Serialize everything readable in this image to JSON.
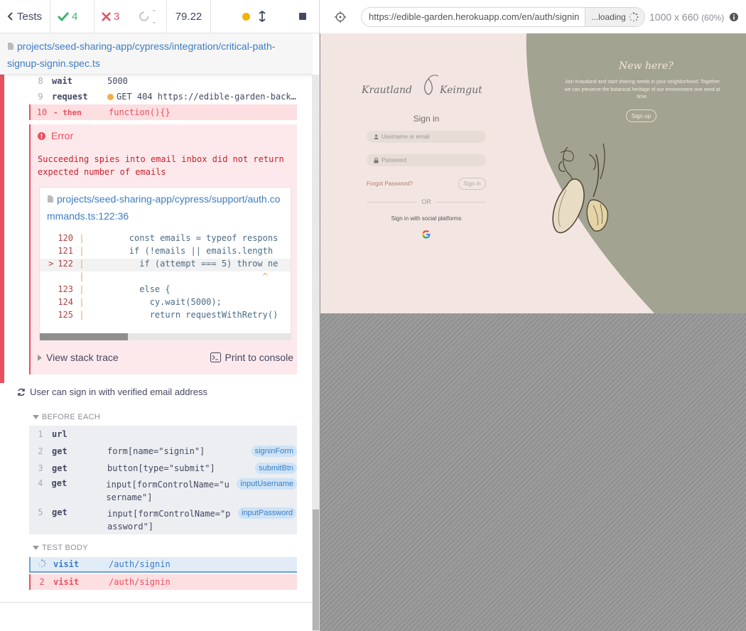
{
  "stats": {
    "tests_label": "Tests",
    "passed": "4",
    "failed": "3",
    "pending": "--",
    "duration": "79.22"
  },
  "spec": {
    "path": "projects/seed-sharing-app/cypress/integration/critical-path-signup-signin.spec.ts"
  },
  "prev_commands": [
    {
      "num": "8",
      "name": "wait",
      "message": "5000"
    },
    {
      "num": "9",
      "name": "request",
      "message": "GET 404 https://edible-garden-backend.h…"
    },
    {
      "num": "10",
      "name": "- then",
      "message": "function(){}"
    }
  ],
  "error": {
    "title": "Error",
    "message": "Succeeding spies into email inbox did not return expected number of emails",
    "file": "projects/seed-sharing-app/cypress/support/auth.commands.ts:122:36",
    "code_lines": [
      {
        "ln": "120",
        "marker": "",
        "text": "        const emails = typeof respons"
      },
      {
        "ln": "121",
        "marker": "",
        "text": "        if (!emails || emails.length "
      },
      {
        "ln": "122",
        "marker": ">",
        "text": "          if (attempt === 5) throw ne"
      },
      {
        "ln": "",
        "marker": "",
        "text": "                                  ^"
      },
      {
        "ln": "123",
        "marker": "",
        "text": "          else {"
      },
      {
        "ln": "124",
        "marker": "",
        "text": "            cy.wait(5000);"
      },
      {
        "ln": "125",
        "marker": "",
        "text": "            return requestWithRetry()"
      }
    ],
    "stack_trace_label": "View stack trace",
    "print_label": "Print to console"
  },
  "test2": {
    "title": "User can sign in with verified email address",
    "before_each_label": "BEFORE EACH",
    "before_each": [
      {
        "num": "1",
        "name": "url",
        "message": "",
        "alias": ""
      },
      {
        "num": "2",
        "name": "get",
        "message": "form[name=\"signin\"]",
        "alias": "signinForm"
      },
      {
        "num": "3",
        "name": "get",
        "message": "button[type=\"submit\"]",
        "alias": "submitBtn"
      },
      {
        "num": "4",
        "name": "get",
        "message": "input[formControlName=\"username\"]",
        "alias": "inputUsername"
      },
      {
        "num": "5",
        "name": "get",
        "message": "input[formControlName=\"password\"]",
        "alias": "inputPassword"
      }
    ],
    "test_body_label": "TEST BODY",
    "test_body": [
      {
        "num": "",
        "name": "visit",
        "message": "/auth/signin",
        "state": "pending"
      },
      {
        "num": "2",
        "name": "visit",
        "message": "/auth/signin",
        "state": "failed"
      }
    ]
  },
  "aut_header": {
    "url": "https://edible-garden.herokuapp.com/en/auth/signin",
    "loading": "...loading",
    "viewport": "1000 x 660",
    "scale": "(60%)"
  },
  "aut": {
    "logo_left": "Krautland",
    "logo_right": "Keimgut",
    "signin_title": "Sign in",
    "username_placeholder": "Username or email",
    "password_placeholder": "Password",
    "forgot": "Forgot Password?",
    "signin_button": "Sign in",
    "or": "OR",
    "social": "Sign in with social platforms",
    "new_here": "New here?",
    "join_text": "Join Krautland and start sharing seeds in your neighborhood. Together we can preserve the botanical heritage of our environment one seed at time.",
    "signup_button": "Sign up"
  },
  "colors": {
    "fail": "#e94f5f",
    "pass": "#3db56c",
    "link": "#3e7cc2",
    "aut_bg": "#f3e6e2",
    "aut_green": "#a3a392"
  }
}
